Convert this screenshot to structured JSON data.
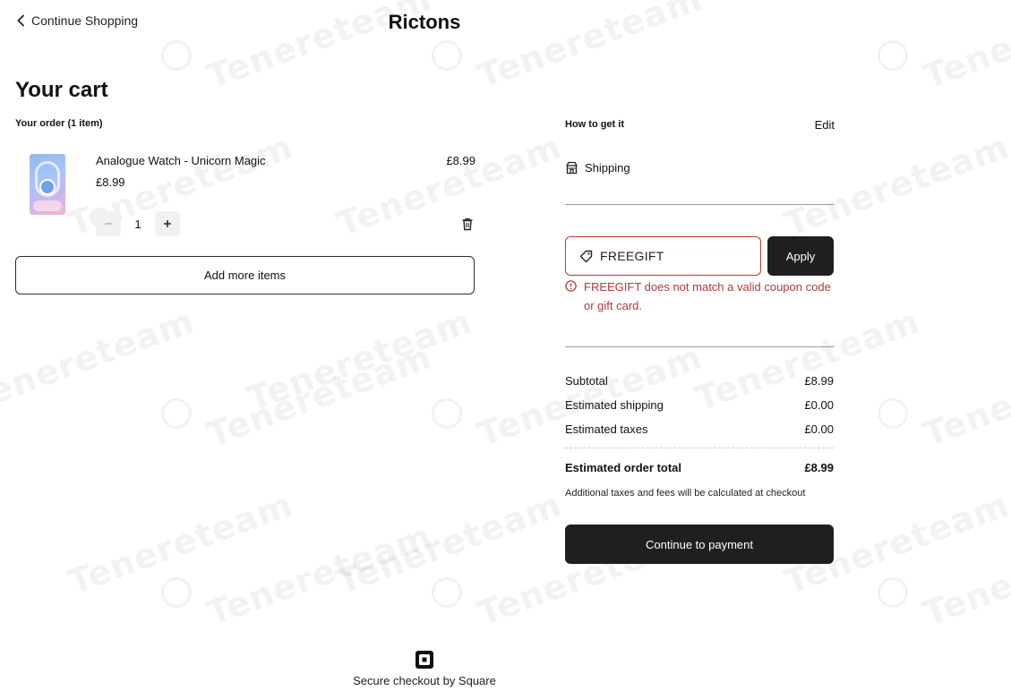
{
  "header": {
    "back_label": "Continue Shopping",
    "store_name": "Rictons"
  },
  "cart": {
    "title": "Your cart",
    "order_count": "Your order (1 item)",
    "items": [
      {
        "name": "Analogue Watch - Unicorn Magic",
        "unit_price": "£8.99",
        "line_total": "£8.99",
        "quantity": "1"
      }
    ],
    "add_more_label": "Add more items"
  },
  "fulfillment": {
    "label": "How to get it",
    "edit_label": "Edit",
    "method": "Shipping"
  },
  "coupon": {
    "value": "FREEGIFT",
    "apply_label": "Apply",
    "error": "FREEGIFT does not match a valid coupon code or gift card."
  },
  "summary": {
    "subtotal_label": "Subtotal",
    "subtotal": "£8.99",
    "shipping_label": "Estimated shipping",
    "shipping": "£0.00",
    "taxes_label": "Estimated taxes",
    "taxes": "£0.00",
    "total_label": "Estimated order total",
    "total": "£8.99",
    "note": "Additional taxes and fees will be calculated at checkout",
    "pay_label": "Continue to payment"
  },
  "footer": {
    "secure_text": "Secure checkout by Square"
  },
  "watermark": {
    "text": "Tenereteam"
  },
  "colors": {
    "primary_button": "#1f1f1f",
    "error": "#b23a3a",
    "error_border": "#c0392b"
  }
}
